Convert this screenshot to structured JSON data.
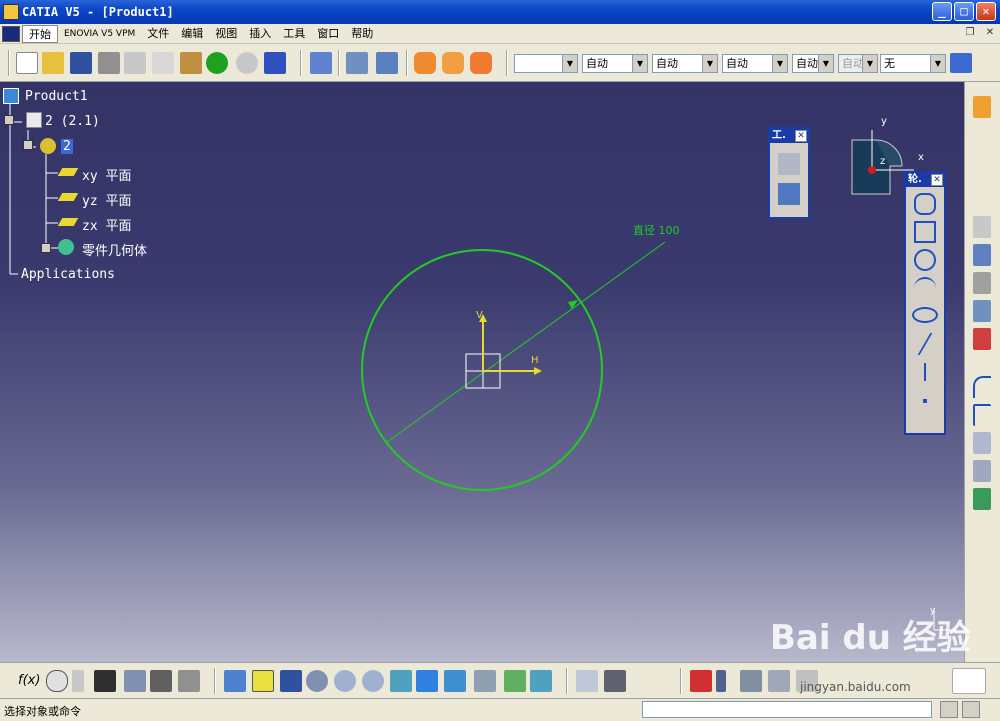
{
  "window": {
    "title": "CATIA V5 - [Product1]",
    "minimize": "_",
    "maximize": "□",
    "close": "✕"
  },
  "menubar": {
    "items": [
      "开始",
      "ENOVIA V5 VPM",
      "文件",
      "编辑",
      "视图",
      "插入",
      "工具",
      "窗口",
      "帮助"
    ],
    "mdi_restore": "❐",
    "mdi_close": "✕"
  },
  "toolbar": {
    "combos": [
      "",
      "自动",
      "自动",
      "自动",
      "自动",
      "自动",
      "无"
    ],
    "icons": [
      "new-file-icon",
      "open-folder-icon",
      "save-icon",
      "print-icon",
      "cut-icon",
      "copy-icon",
      "paste-icon",
      "undo-icon",
      "redo-icon",
      "whats-this-icon",
      "fly-icon",
      "sketch-tools-icon",
      "stack-icon",
      "sketch-orange-icon",
      "sketch-orange2-icon",
      "sketch-orange3-icon",
      "paint-brush-icon"
    ]
  },
  "tree": {
    "root": "Product1",
    "part": "2 (2.1)",
    "body": "2",
    "planes": [
      "xy 平面",
      "yz 平面",
      "zx 平面"
    ],
    "geometry": "零件几何体",
    "applications": "Applications"
  },
  "sketch": {
    "dimension_label": "直径 100",
    "axis_v": "V",
    "axis_h": "H",
    "circle_color": "#22cc22",
    "axis_color": "#e8d830",
    "diameter": 100
  },
  "compass": {
    "y": "y",
    "x": "x",
    "z": "z"
  },
  "float_toolbar_tools": {
    "title": "工.",
    "close": "✕"
  },
  "float_toolbar_profile": {
    "title": "轮.",
    "close": "✕"
  },
  "axis_indicator": {
    "y": "y",
    "x": "x"
  },
  "status": {
    "text": "选择对象或命令"
  },
  "watermark": {
    "brand": "Bai du 经验",
    "url": "jingyan.baidu.com"
  },
  "bottom_toolbar": {
    "formula_label": "f(x)"
  },
  "colors": {
    "title_blue": "#0a46c8",
    "viewport_top": "#333366",
    "viewport_bottom": "#b8b8cc",
    "sketch_green": "#22cc22",
    "axis_yellow": "#e8d830"
  }
}
